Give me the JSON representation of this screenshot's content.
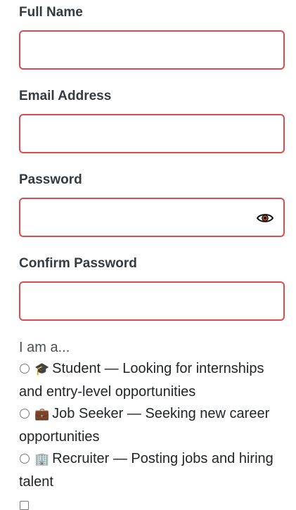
{
  "fields": [
    {
      "id": "full-name",
      "label": "Full Name",
      "value": "",
      "placeholder": ""
    },
    {
      "id": "email",
      "label": "Email Address",
      "value": "",
      "placeholder": ""
    },
    {
      "id": "password",
      "label": "Password",
      "value": "",
      "placeholder": ""
    },
    {
      "id": "confirm-password",
      "label": "Confirm Password",
      "value": "",
      "placeholder": ""
    }
  ],
  "password_toggle_icon": "eye-icon",
  "role": {
    "heading": "I am a...",
    "options": [
      {
        "icon": "graduation-cap-icon",
        "glyph": "🎓",
        "text": "Student — Looking for internships and entry-level opportunities",
        "selected": false
      },
      {
        "icon": "briefcase-icon",
        "glyph": "💼",
        "text": "Job Seeker — Seeking new career opportunities",
        "selected": false
      },
      {
        "icon": "office-building-icon",
        "glyph": "🏢",
        "text": "Recruiter — Posting jobs and hiring talent",
        "selected": false
      }
    ]
  },
  "colors": {
    "input_border_error": "#dc4c4c",
    "label_text": "#333a40"
  }
}
